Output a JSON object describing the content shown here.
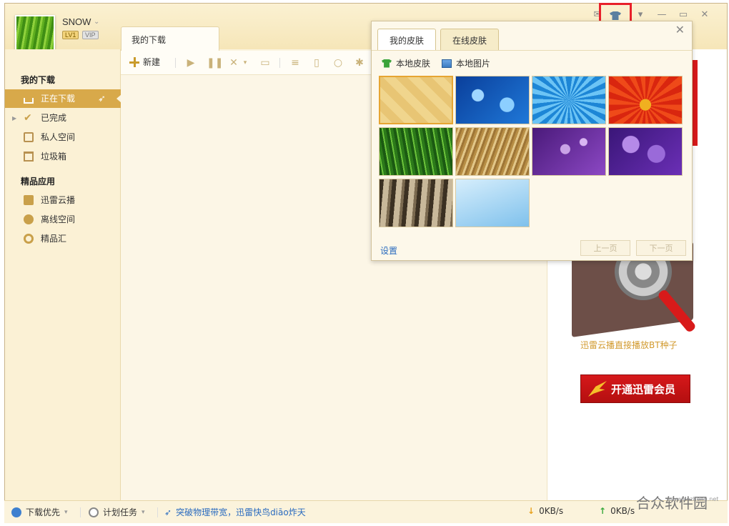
{
  "user": {
    "name": "SNOW",
    "level_badge": "LV1",
    "vip_badge": "VIP"
  },
  "main_tab": "我的下载",
  "sidebar": {
    "section1_title": "我的下载",
    "items1": [
      {
        "label": "正在下载",
        "icon": "download-icon"
      },
      {
        "label": "已完成",
        "icon": "check-icon"
      },
      {
        "label": "私人空间",
        "icon": "lock-icon"
      },
      {
        "label": "垃圾箱",
        "icon": "trash-icon"
      }
    ],
    "section2_title": "精品应用",
    "items2": [
      {
        "label": "迅雷云播",
        "icon": "cloud-play-icon"
      },
      {
        "label": "离线空间",
        "icon": "offline-icon"
      },
      {
        "label": "精品汇",
        "icon": "apps-icon"
      }
    ]
  },
  "toolbar": {
    "new_label": "新建"
  },
  "skin_popup": {
    "tab_my_skin": "我的皮肤",
    "tab_online_skin": "在线皮肤",
    "local_skin": "本地皮肤",
    "local_image": "本地图片",
    "settings": "设置",
    "prev_page": "上一页",
    "next_page": "下一页"
  },
  "ad": {
    "caption": "迅雷云播直接播放BT种子",
    "vip_button": "开通迅雷会员"
  },
  "statusbar": {
    "priority": "下载优先",
    "schedule": "计划任务",
    "tip": "突破物理带宽，迅雷快鸟diāo炸天",
    "down_speed": "0KB/s",
    "up_speed": "0KB/s"
  },
  "watermark": {
    "text": "合众软件园",
    "url": "www.hezhong.net"
  },
  "colors": {
    "accent": "#d8a94a",
    "highlight_box": "#e8202a",
    "link": "#2a6bbf"
  }
}
